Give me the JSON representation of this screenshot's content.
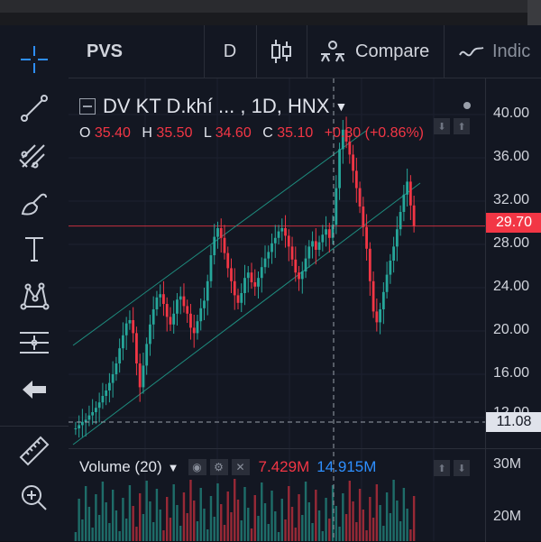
{
  "colors": {
    "up": "#26a69a",
    "down": "#f23645",
    "channel": "#1e8c7e",
    "price_line": "#f23645",
    "volume_blue": "#2e8fff",
    "background": "#131722"
  },
  "header": {
    "symbol": "PVS",
    "interval": "D",
    "compare_label": "Compare",
    "indicators_label": "Indic"
  },
  "legend": {
    "title": "DV KT D.khí ... , 1D, HNX",
    "open_label": "O",
    "open": "35.40",
    "high_label": "H",
    "high": "35.50",
    "low_label": "L",
    "low": "34.60",
    "close_label": "C",
    "close": "35.10",
    "change": "+0.30 (+0.86%)"
  },
  "price_axis": {
    "ticks": [
      "40.00",
      "36.00",
      "32.00",
      "28.00",
      "24.00",
      "20.00",
      "16.00",
      "12.00"
    ],
    "current_price": "29.70",
    "crosshair_price": "11.08"
  },
  "volume": {
    "title": "Volume (20)",
    "value": "7.429M",
    "ma_value": "14.915M",
    "axis_ticks": [
      "30M",
      "20M"
    ]
  },
  "toolbar": {
    "tools": [
      "crosshair-icon",
      "trend-line-icon",
      "pitchfork-icon",
      "brush-icon",
      "text-icon",
      "pattern-icon",
      "measure-lines-icon",
      "back-arrow-icon",
      "ruler-icon",
      "zoom-in-icon"
    ]
  },
  "chart_data": {
    "type": "candlestick",
    "symbol": "PVS",
    "interval": "1D",
    "exchange": "HNX",
    "y_range": [
      10,
      41
    ],
    "close_series": [
      11.0,
      11.3,
      11.6,
      11.8,
      12.2,
      12.5,
      12.9,
      13.4,
      14.0,
      14.5,
      15.2,
      16.0,
      17.0,
      18.4,
      19.6,
      20.7,
      21.0,
      19.8,
      17.0,
      14.8,
      16.8,
      18.8,
      20.6,
      22.0,
      23.1,
      23.4,
      22.5,
      21.3,
      20.6,
      21.6,
      22.9,
      23.2,
      22.3,
      21.6,
      20.3,
      19.8,
      20.9,
      22.1,
      22.8,
      24.6,
      27.0,
      28.7,
      29.5,
      28.6,
      27.2,
      25.8,
      24.6,
      23.3,
      22.6,
      23.5,
      24.9,
      25.4,
      24.5,
      24.1,
      24.9,
      25.9,
      26.7,
      27.3,
      28.1,
      28.6,
      29.2,
      29.5,
      28.8,
      27.8,
      26.6,
      25.4,
      24.8,
      25.5,
      26.7,
      27.8,
      28.3,
      27.5,
      28.2,
      28.9,
      29.4,
      28.6,
      29.8,
      33.2,
      36.8,
      38.6,
      37.5,
      36.3,
      34.8,
      33.2,
      31.5,
      29.6,
      27.6,
      24.6,
      21.8,
      20.8,
      22.0,
      23.6,
      25.2,
      26.5,
      27.8,
      29.4,
      31.0,
      32.6,
      33.8,
      31.6,
      29.7
    ],
    "volume_ticks": [
      "30M",
      "20M"
    ]
  }
}
